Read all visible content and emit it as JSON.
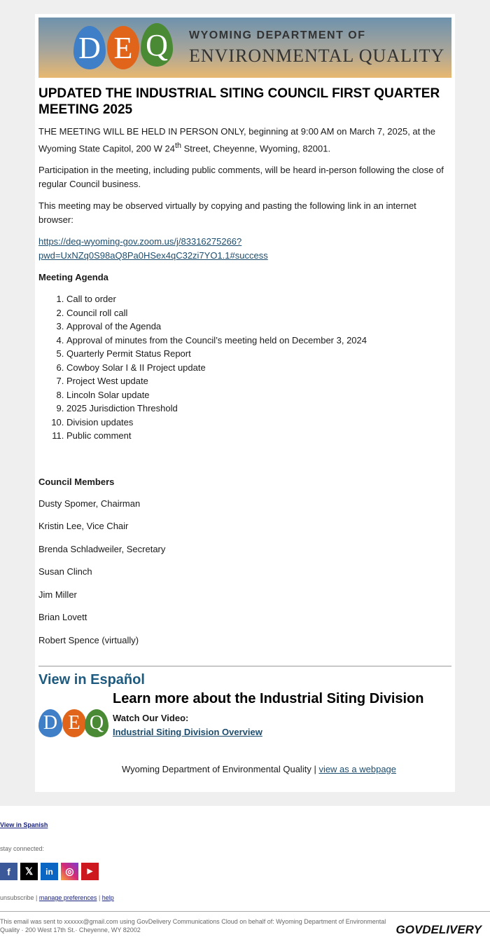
{
  "banner": {
    "line1": "WYOMING DEPARTMENT OF",
    "line2": "ENVIRONMENTAL QUALITY",
    "logo_letters": [
      "D",
      "E",
      "Q"
    ],
    "colors": [
      "#3f7fc8",
      "#e0651a",
      "#4a8a34"
    ]
  },
  "title": "UPDATED THE INDUSTRIAL SITING COUNCIL FIRST QUARTER MEETING 2025",
  "para1_a": "THE MEETING WILL BE HELD IN PERSON ONLY, beginning at 9:00 AM on March 7, 2025, at the Wyoming State Capitol, 200 W 24",
  "para1_sup": "th",
  "para1_b": " Street, Cheyenne, Wyoming, 82001.",
  "para2": "Participation in the meeting, including public comments, will be heard in-person following the close of regular Council business.",
  "para3": "This meeting may be observed virtually by copying and pasting the following link in an internet browser:",
  "zoom_link_1": "https://deq-wyoming-gov.zoom.us/j/83316275266?",
  "zoom_link_2": "pwd=UxNZq0S98aQ8Pa0HSex4qC32zi7YO1.1#success",
  "agenda_title": "Meeting Agenda",
  "agenda": [
    "Call to order",
    "Council roll call",
    "Approval of the Agenda",
    "Approval of minutes from the Council’s meeting held on December 3, 2024",
    "Quarterly Permit Status Report",
    "Cowboy Solar I & II Project update",
    "Project West update",
    "Lincoln Solar update",
    "2025 Jurisdiction Threshold",
    "Division updates",
    "Public comment"
  ],
  "members_title": "Council Members",
  "members": [
    "Dusty Spomer, Chairman",
    "Kristin Lee, Vice Chair",
    "Brenda Schladweiler, Secretary",
    "Susan Clinch",
    "Jim Miller",
    "Brian Lovett",
    "Robert Spence (virtually)"
  ],
  "espanol": "View in Español",
  "learn_title": "Learn more about the Industrial Siting Division",
  "watch": "Watch Our Video:",
  "video_link": "Industrial Siting Division Overview",
  "signature": "Wyoming Department of Environmental Quality",
  "sig_sep": " | ",
  "webpage_link": "view as a webpage",
  "footer": {
    "spanish": "View in Spanish",
    "stay": "stay connected:",
    "social": [
      "facebook",
      "x",
      "linkedin",
      "instagram",
      "youtube"
    ],
    "unsubscribe": "unsubscribe",
    "manage": "manage preferences",
    "help": "help",
    "sep": " | ",
    "sent": "This email was sent to xxxxxx@gmail.com using GovDelivery Communications Cloud on behalf of: Wyoming Department of Environmental Quality · 200 West 17th St.· Cheyenne, WY 82002",
    "brand": "GOVDELIVERY"
  }
}
